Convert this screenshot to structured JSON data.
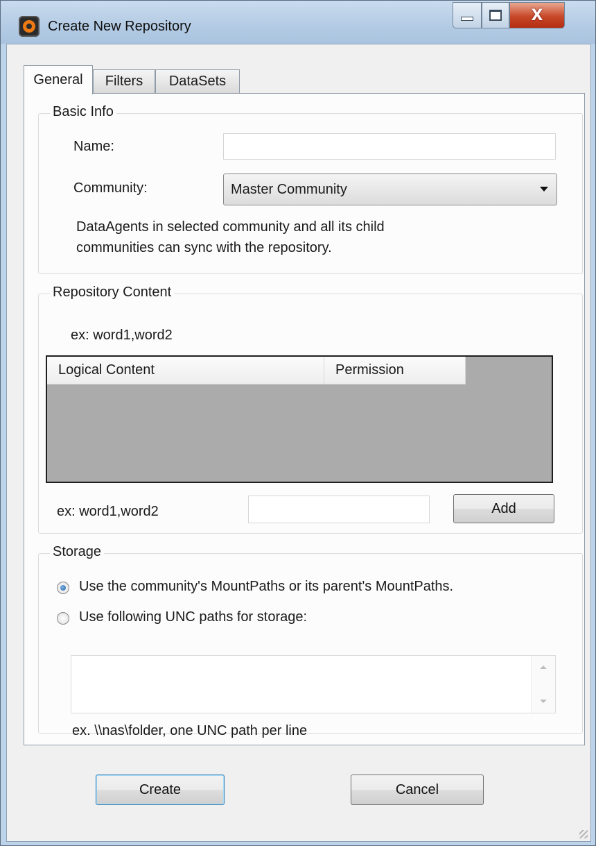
{
  "window": {
    "title": "Create New Repository",
    "close_glyph": "X"
  },
  "tabs": [
    {
      "label": "General",
      "active": true
    },
    {
      "label": "Filters",
      "active": false
    },
    {
      "label": "DataSets",
      "active": false
    }
  ],
  "basic_info": {
    "legend": "Basic Info",
    "name_label": "Name:",
    "name_value": "",
    "community_label": "Community:",
    "community_value": "Master Community",
    "help_line1": "DataAgents in selected community and all its child",
    "help_line2": "communities can sync with the repository."
  },
  "repository_content": {
    "legend": "Repository Content",
    "example_top": "ex: word1,word2",
    "columns": [
      "Logical Content",
      "Permission"
    ],
    "rows": [],
    "example_bottom": "ex: word1,word2",
    "content_value": "",
    "add_label": "Add"
  },
  "storage": {
    "legend": "Storage",
    "option1": "Use the community's MountPaths or its parent's MountPaths.",
    "option2": "Use following UNC paths for storage:",
    "selected": "option1",
    "paths_value": "",
    "hint": "ex. \\\\nas\\folder, one UNC path per line"
  },
  "footer": {
    "create_label": "Create",
    "cancel_label": "Cancel"
  },
  "colors": {
    "title_bar": "#b3cbe4",
    "close_button": "#c8482a",
    "grid_background": "#ababab",
    "accent_radio": "#1f5da2"
  }
}
